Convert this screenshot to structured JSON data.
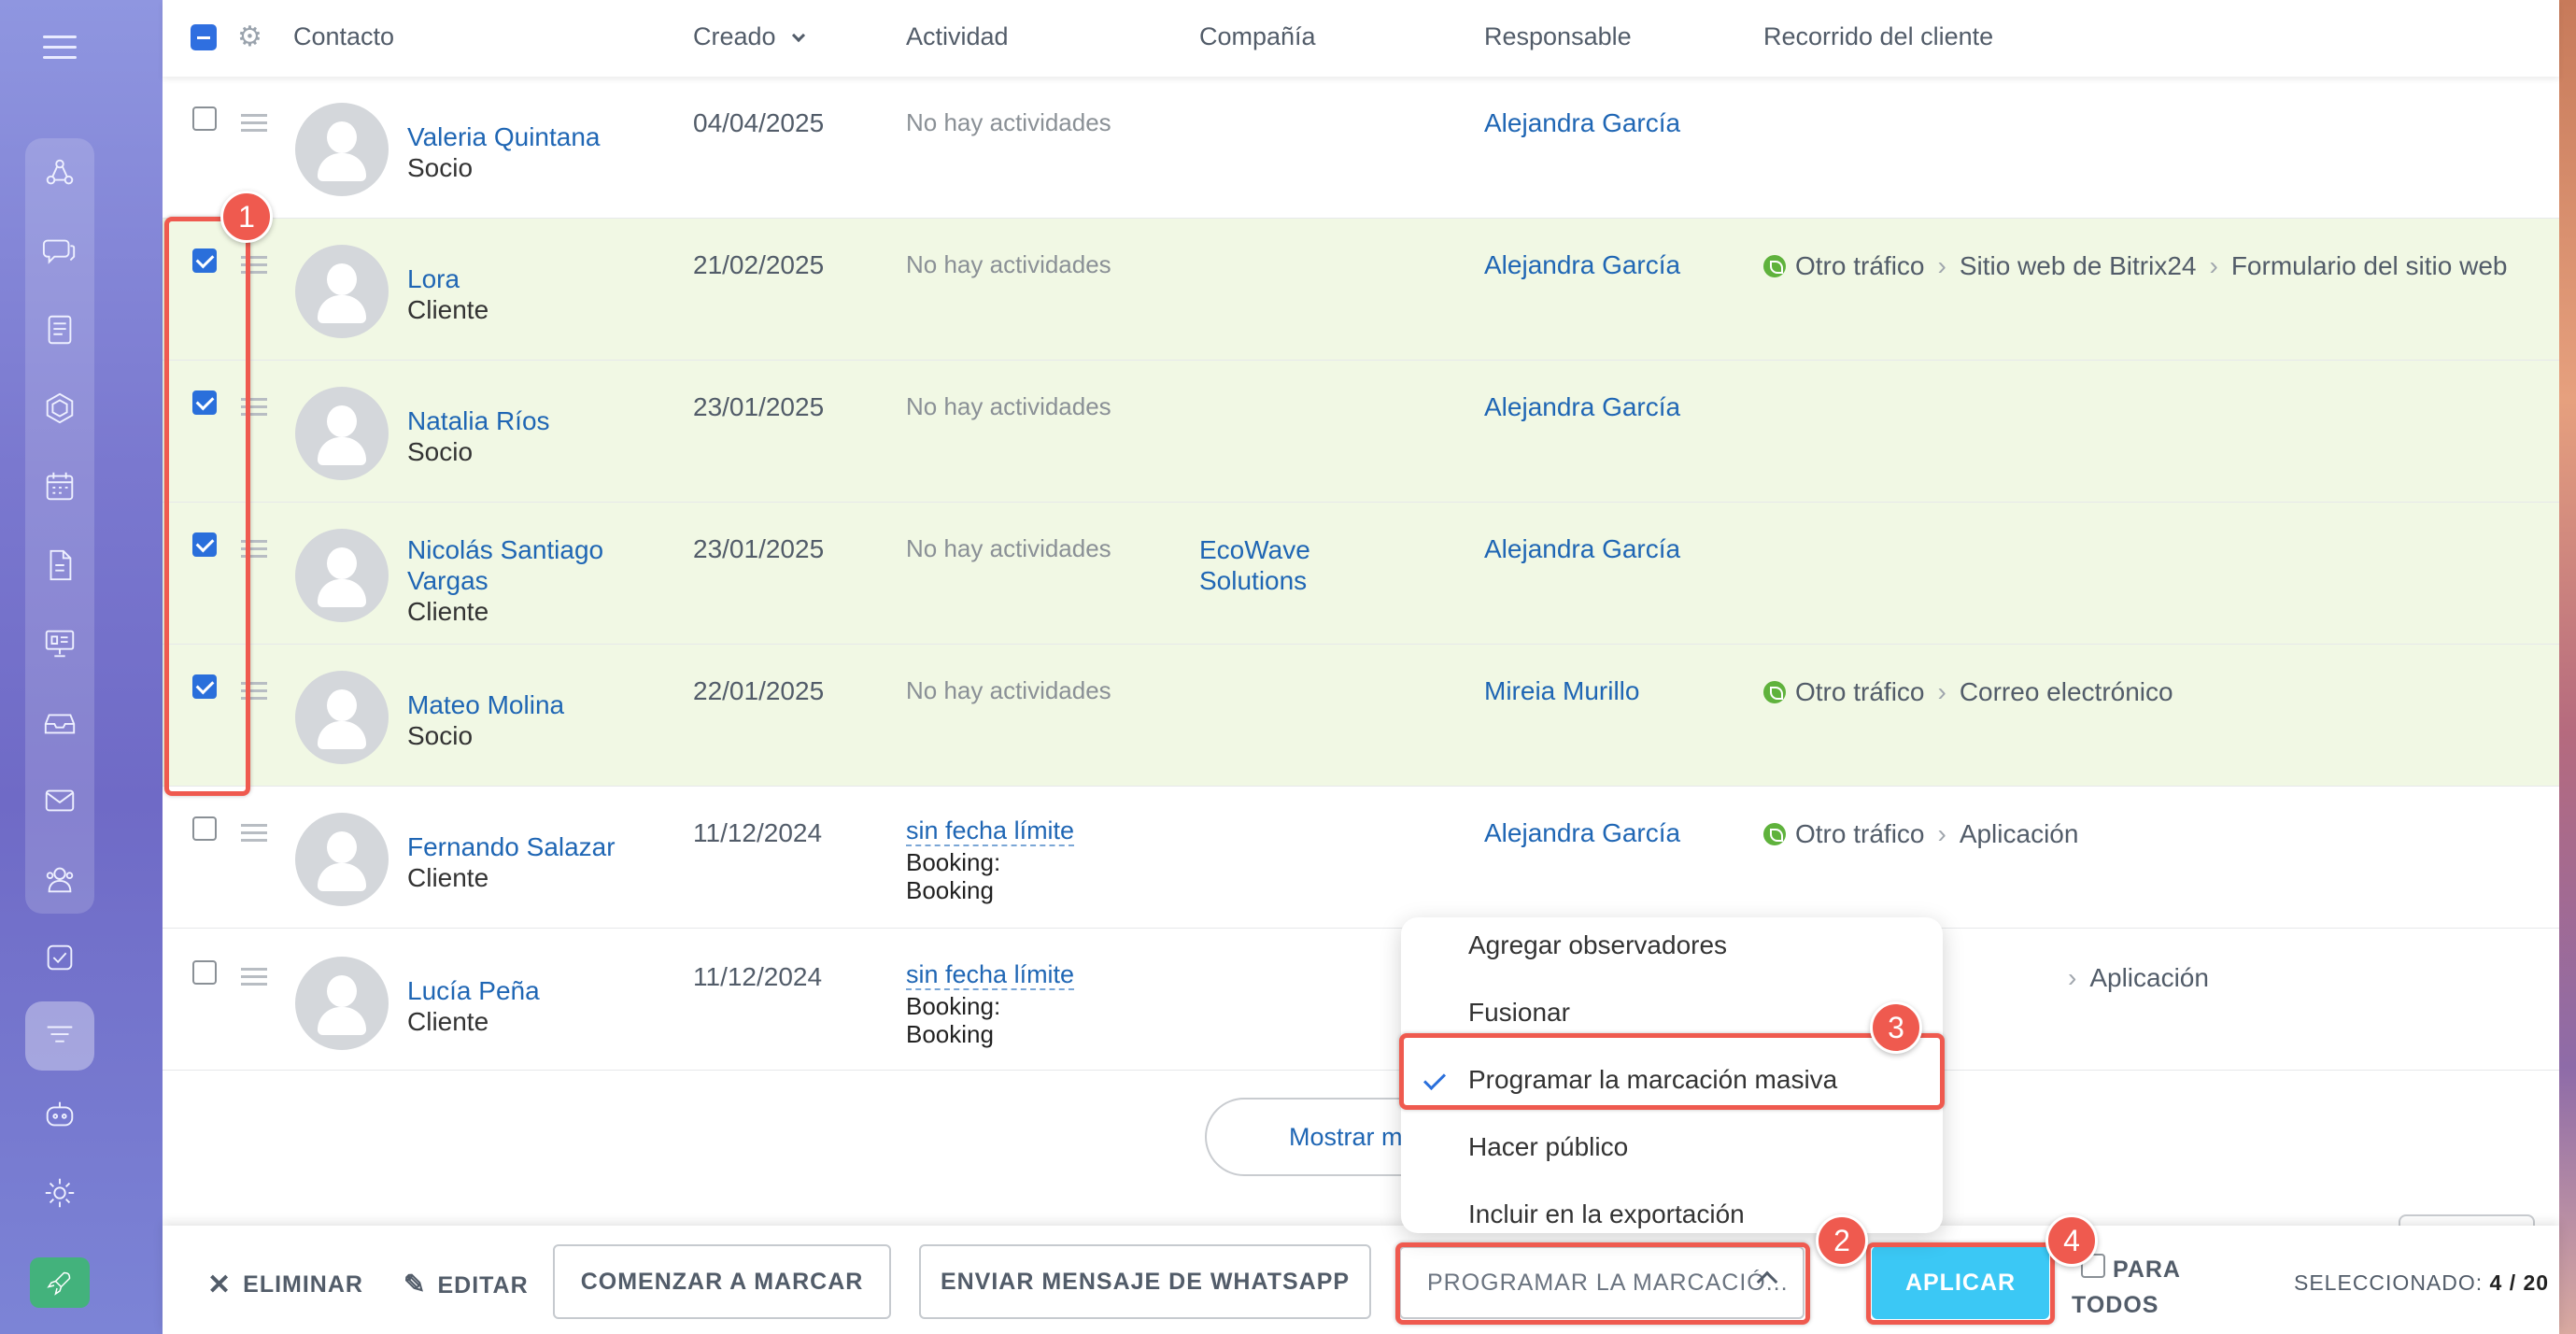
{
  "header": {
    "contact": "Contacto",
    "created": "Creado",
    "activity": "Actividad",
    "company": "Compañía",
    "responsible": "Responsable",
    "journey": "Recorrido del cliente"
  },
  "rows": [
    {
      "name": "Valeria Quintana",
      "type": "Socio",
      "date": "04/04/2025",
      "activity": "No hay actividades",
      "responsible": "Alejandra García",
      "checked": false
    },
    {
      "name": "Lora",
      "type": "Cliente",
      "date": "21/02/2025",
      "activity": "No hay actividades",
      "responsible": "Alejandra García",
      "journey": [
        "Otro tráfico",
        "Sitio web de Bitrix24",
        "Formulario del sitio web"
      ],
      "checked": true
    },
    {
      "name": "Natalia Ríos",
      "type": "Socio",
      "date": "23/01/2025",
      "activity": "No hay actividades",
      "responsible": "Alejandra García",
      "checked": true
    },
    {
      "name": "Nicolás Santiago Vargas",
      "type": "Cliente",
      "date": "23/01/2025",
      "activity": "No hay actividades",
      "company": "EcoWave Solutions",
      "responsible": "Alejandra García",
      "checked": true
    },
    {
      "name": "Mateo Molina",
      "type": "Socio",
      "date": "22/01/2025",
      "activity": "No hay actividades",
      "responsible": "Mireia Murillo",
      "journey": [
        "Otro tráfico",
        "Correo electrónico"
      ],
      "checked": true
    },
    {
      "name": "Fernando Salazar",
      "type": "Cliente",
      "date": "11/12/2024",
      "activity_link": "sin fecha límite",
      "activity_sub": "Booking: Booking",
      "responsible": "Alejandra García",
      "journey": [
        "Otro tráfico",
        "Aplicación"
      ],
      "checked": false
    },
    {
      "name": "Lucía Peña",
      "type": "Cliente",
      "date": "11/12/2024",
      "activity_link": "sin fecha límite",
      "activity_sub": "Booking: Booking",
      "journey_tail": "Aplicación",
      "checked": false
    }
  ],
  "show_more": "Mostrar m",
  "dropdown": {
    "items": [
      "Agregar observadores",
      "Fusionar",
      "Programar la marcación masiva",
      "Hacer público",
      "Incluir en la exportación"
    ],
    "selected": "Programar la marcación masiva"
  },
  "actionbar": {
    "delete": "ELIMINAR",
    "edit": "EDITAR",
    "start_dialing": "COMENZAR A MARCAR",
    "whatsapp": "ENVIAR MENSAJE DE WHATSAPP",
    "select_value": "PROGRAMAR LA MARCACIÓ...",
    "apply": "APLICAR",
    "for_all": "PARA TODOS",
    "selected_label": "SELECCIONADO:",
    "selected_value": "4 / 20"
  },
  "annotations": [
    "1",
    "2",
    "3",
    "4"
  ],
  "colors": {
    "accent": "#2a6fdb",
    "link": "#1f66b4",
    "selected_row": "#f1f8e4",
    "apply": "#3bc8f5",
    "annotation": "#ef5a4f"
  },
  "icons": {
    "sidebar": [
      "menu-icon",
      "crm-icon",
      "chat-icon",
      "feed-icon",
      "hexagon-icon",
      "calendar-icon",
      "document-icon",
      "presentation-icon",
      "inbox-icon",
      "mail-icon",
      "contacts-icon",
      "tasks-icon",
      "funnel-icon",
      "robot-icon",
      "gear-icon",
      "rocket-icon"
    ]
  }
}
